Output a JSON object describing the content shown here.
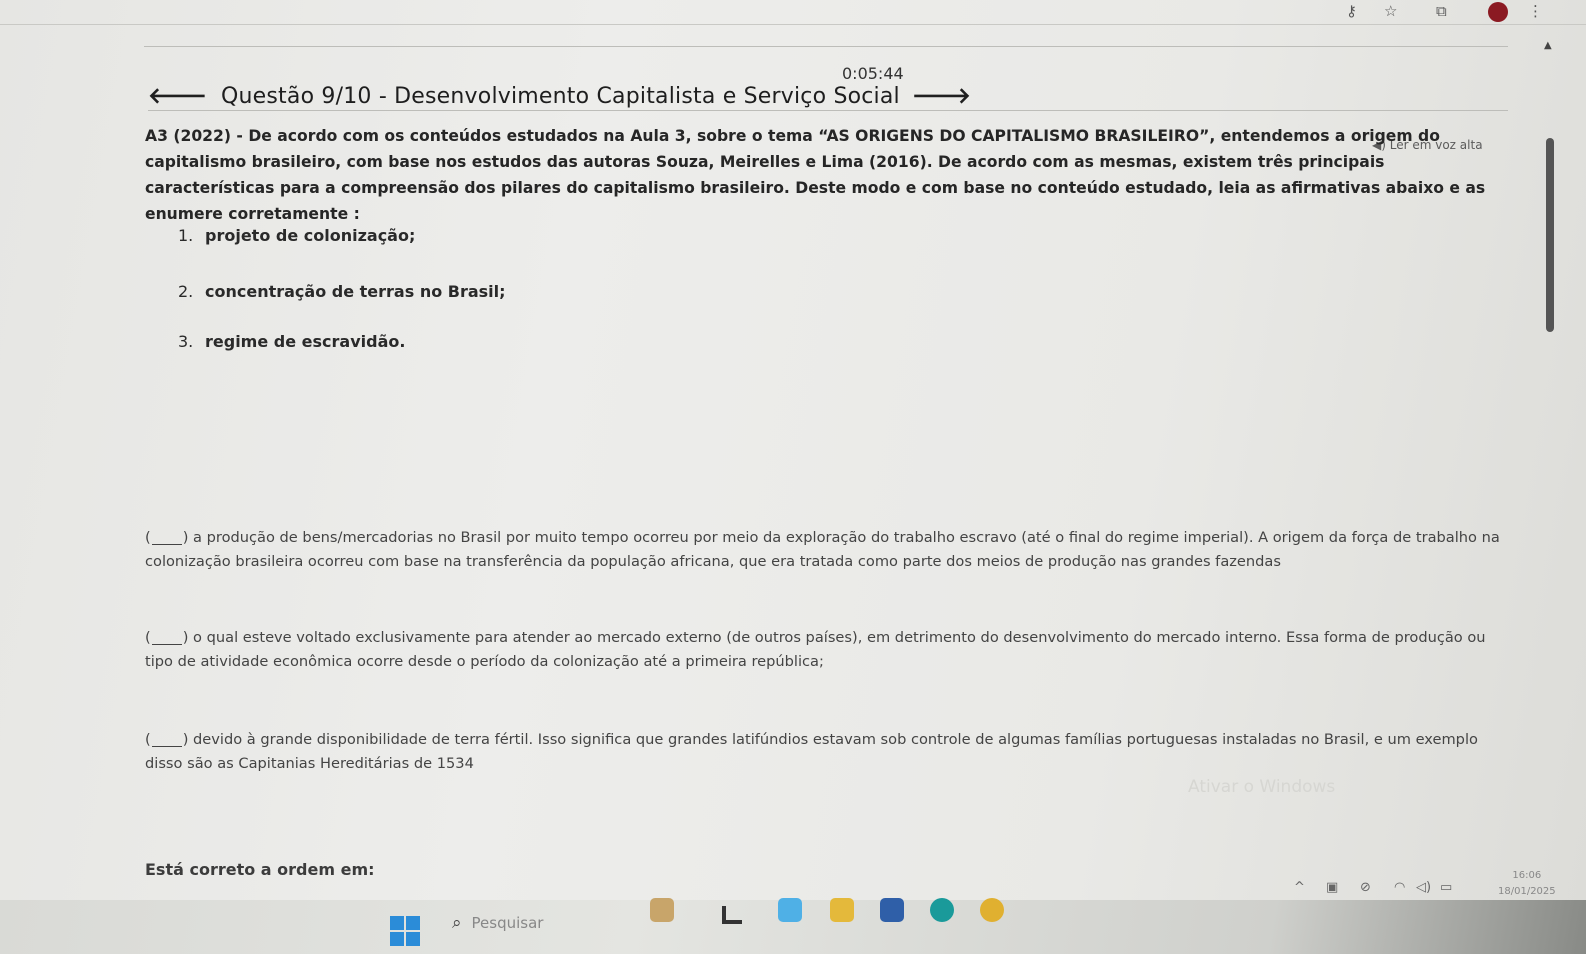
{
  "timer": "0:05:44",
  "question": {
    "title": "Questão 9/10 - Desenvolvimento Capitalista e Serviço Social",
    "read_aloud": "Ler em voz alta",
    "statement": "A3 (2022) - De acordo com os conteúdos estudados na Aula 3, sobre o tema “AS ORIGENS DO CAPITALISMO BRASILEIRO”, entendemos a origem do capitalismo brasileiro, com base nos estudos das autoras Souza, Meirelles e Lima (2016). De acordo com as mesmas, existem três principais características para a compreensão dos pilares do capitalismo brasileiro. Deste modo e com base no conteúdo estudado, leia as afirmativas abaixo e as enumere corretamente :",
    "items": [
      {
        "num": "1.",
        "text": "projeto de colonização;"
      },
      {
        "num": "2.",
        "text": "concentração de terras no Brasil;"
      },
      {
        "num": "3.",
        "text": "regime de escravidão."
      }
    ],
    "affirmatives": [
      "a produção de bens/mercadorias no Brasil por muito tempo ocorreu por meio da exploração do trabalho escravo (até o final do regime imperial). A origem da força de trabalho na colonização brasileira ocorreu com base na transferência da população africana, que era tratada como parte dos meios de produção nas grandes fazendas",
      "o qual esteve voltado exclusivamente para atender ao mercado externo (de outros países), em detrimento do desenvolvimento do mercado interno. Essa forma de produção ou tipo de atividade econômica ocorre desde o período da colonização até a primeira república;",
      "devido à grande disponibilidade de terra fértil. Isso significa que grandes latifúndios estavam sob controle de algumas famílias portuguesas instaladas no Brasil, e um exemplo disso são as Capitanias Hereditárias de 1534"
    ],
    "footer_prompt": "Está correto a ordem em:"
  },
  "watermark": "Ativar o Windows",
  "taskbar": {
    "search_placeholder": "Pesquisar",
    "clock_time": "16:06",
    "clock_date": "18/01/2025"
  },
  "icons": {
    "back": "arrow-left-icon",
    "forward": "arrow-right-icon",
    "speaker": "speaker-icon",
    "search": "search-icon"
  },
  "colors": {
    "windows_blue": "#2b8cd8",
    "profile": "#8b1a22"
  }
}
